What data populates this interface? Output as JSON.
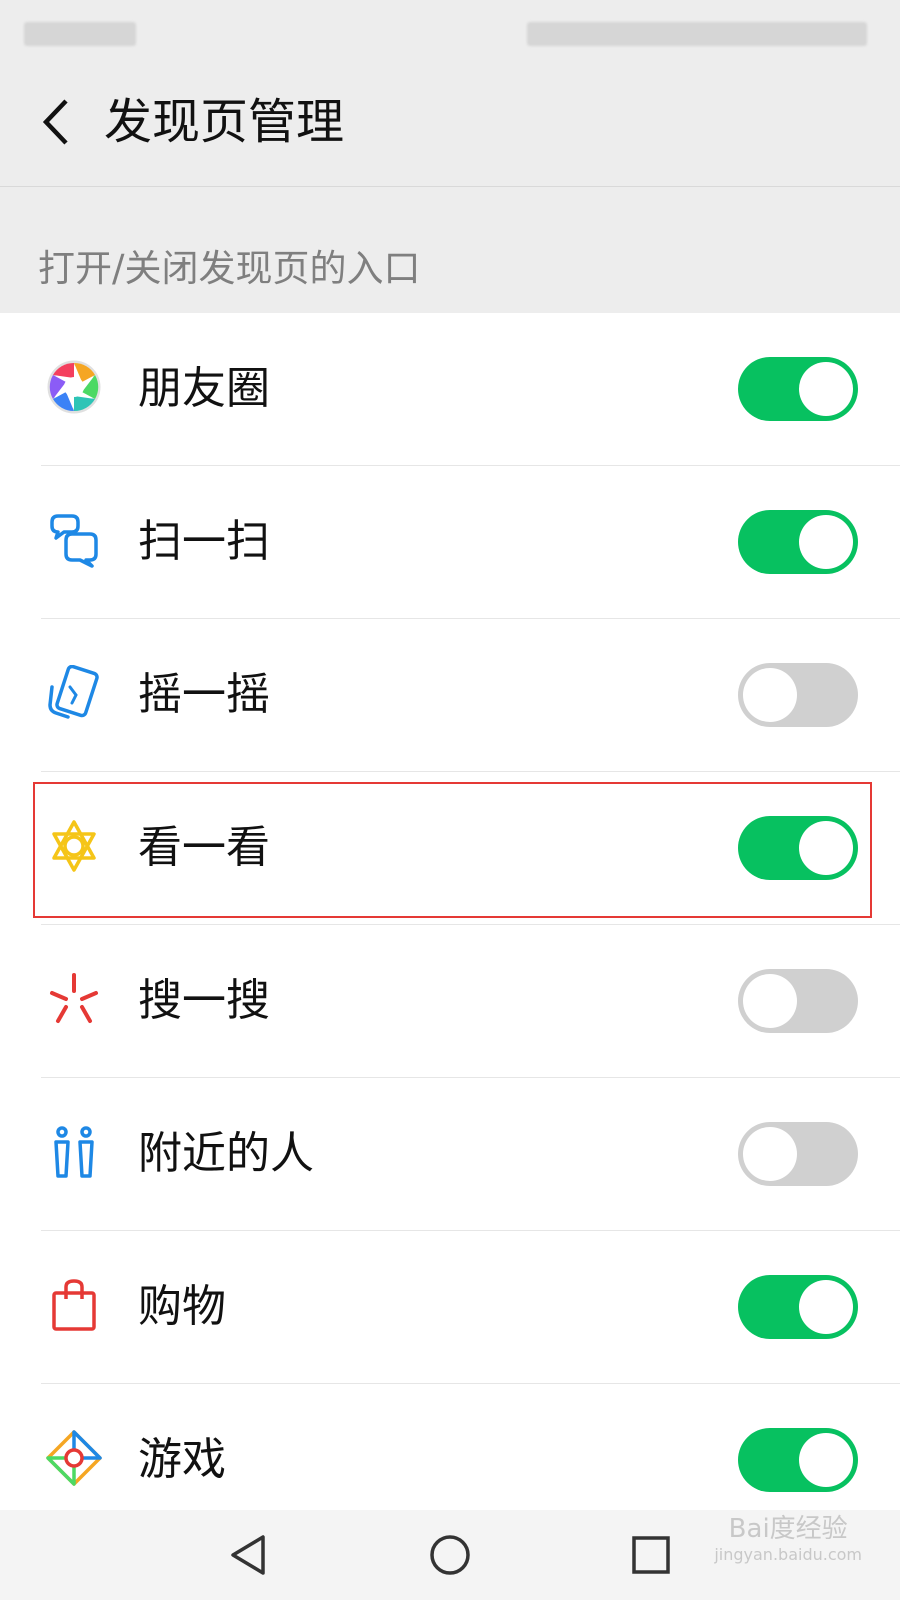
{
  "header": {
    "title": "发现页管理"
  },
  "section": {
    "label": "打开/关闭发现页的入口"
  },
  "items": [
    {
      "label": "朋友圈",
      "icon": "moments-icon",
      "enabled": true
    },
    {
      "label": "扫一扫",
      "icon": "scan-icon",
      "enabled": true
    },
    {
      "label": "摇一摇",
      "icon": "shake-icon",
      "enabled": false
    },
    {
      "label": "看一看",
      "icon": "top-stories-icon",
      "enabled": true
    },
    {
      "label": "搜一搜",
      "icon": "search-icon",
      "enabled": false
    },
    {
      "label": "附近的人",
      "icon": "people-nearby-icon",
      "enabled": false
    },
    {
      "label": "购物",
      "icon": "shopping-bag-icon",
      "enabled": true
    },
    {
      "label": "游戏",
      "icon": "games-icon",
      "enabled": true
    }
  ],
  "colors": {
    "toggle_on": "#07c160",
    "toggle_off": "#d0d0d0",
    "highlight": "#e53935"
  },
  "navbar": {
    "buttons": [
      "back-triangle-icon",
      "home-circle-icon",
      "recents-square-icon"
    ]
  },
  "watermark": {
    "brand": "Bai度经验",
    "url": "jingyan.baidu.com"
  }
}
